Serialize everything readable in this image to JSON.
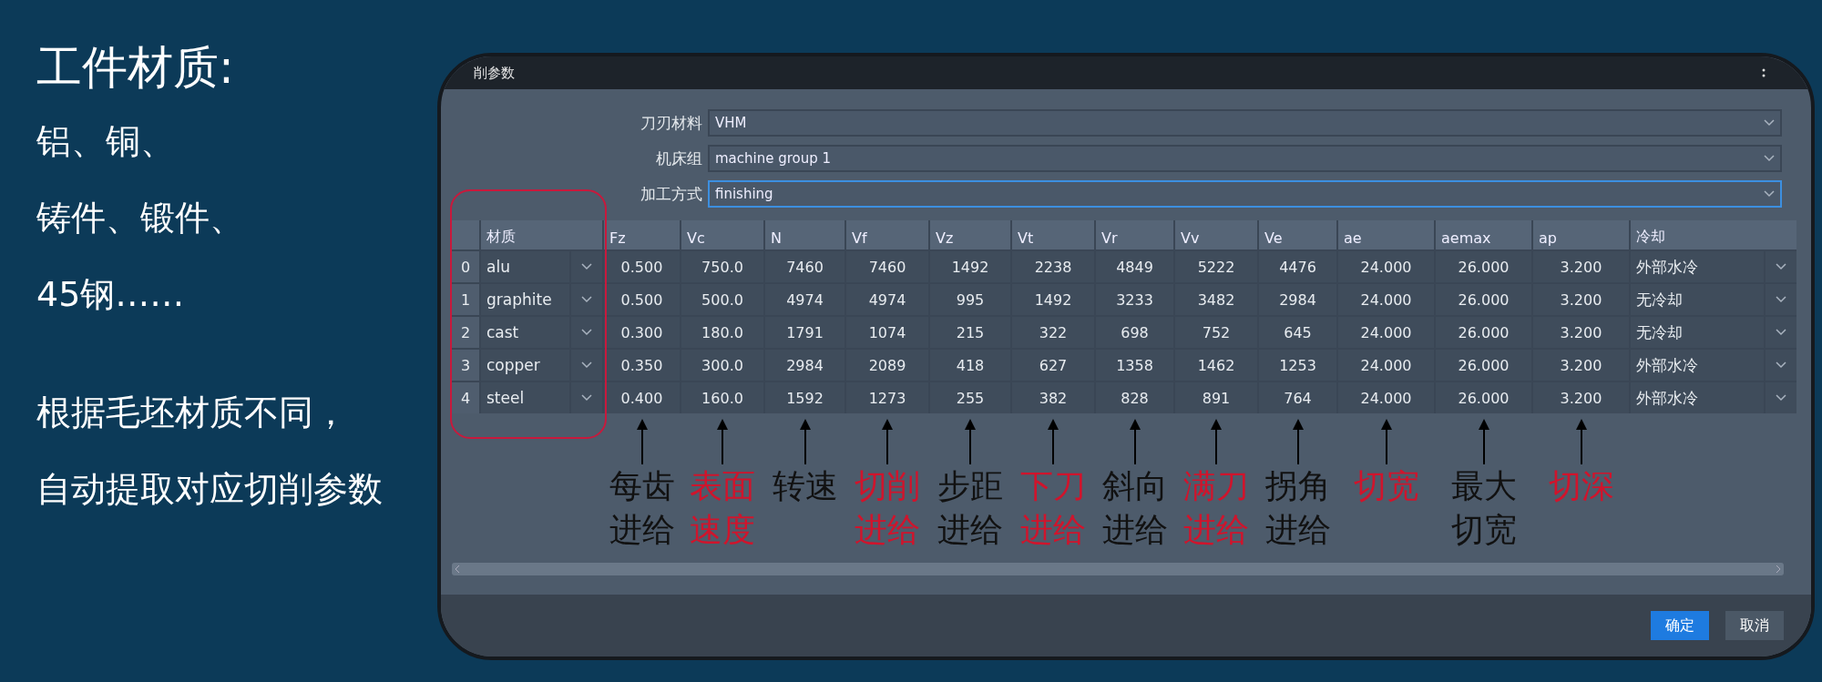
{
  "slide": {
    "heading": "工件材质:",
    "lines": [
      "铝、铜、",
      "铸件、锻件、",
      "45钢……"
    ],
    "note_lines": [
      "根据毛坯材质不同，",
      "自动提取对应切削参数"
    ]
  },
  "window": {
    "title": "削参数"
  },
  "form": [
    {
      "label": "刀刃材料",
      "value": "VHM",
      "focused": false
    },
    {
      "label": "机床组",
      "value": "machine group 1",
      "focused": false
    },
    {
      "label": "加工方式",
      "value": "finishing",
      "focused": true
    }
  ],
  "table": {
    "columns": [
      "",
      "材质",
      "Fz",
      "Vc",
      "N",
      "Vf",
      "Vz",
      "Vt",
      "Vr",
      "Vv",
      "Ve",
      "ae",
      "aemax",
      "ap",
      "冷却"
    ],
    "rows": [
      {
        "index": "0",
        "material": "alu",
        "cells": [
          "0.500",
          "750.0",
          "7460",
          "7460",
          "1492",
          "2238",
          "4849",
          "5222",
          "4476",
          "24.000",
          "26.000",
          "3.200"
        ],
        "cooling": "外部水冷"
      },
      {
        "index": "1",
        "material": "graphite",
        "cells": [
          "0.500",
          "500.0",
          "4974",
          "4974",
          "995",
          "1492",
          "3233",
          "3482",
          "2984",
          "24.000",
          "26.000",
          "3.200"
        ],
        "cooling": "无冷却"
      },
      {
        "index": "2",
        "material": "cast",
        "cells": [
          "0.300",
          "180.0",
          "1791",
          "1074",
          "215",
          "322",
          "698",
          "752",
          "645",
          "24.000",
          "26.000",
          "3.200"
        ],
        "cooling": "无冷却"
      },
      {
        "index": "3",
        "material": "copper",
        "cells": [
          "0.350",
          "300.0",
          "2984",
          "2089",
          "418",
          "627",
          "1358",
          "1462",
          "1253",
          "24.000",
          "26.000",
          "3.200"
        ],
        "cooling": "外部水冷"
      },
      {
        "index": "4",
        "material": "steel",
        "cells": [
          "0.400",
          "160.0",
          "1592",
          "1273",
          "255",
          "382",
          "828",
          "891",
          "764",
          "24.000",
          "26.000",
          "3.200"
        ],
        "cooling": "外部水冷"
      }
    ]
  },
  "annotations": [
    {
      "lines": [
        "每齿",
        "进给"
      ],
      "color": "#111111"
    },
    {
      "lines": [
        "表面",
        "速度"
      ],
      "color": "#d0142c"
    },
    {
      "lines": [
        "转速"
      ],
      "color": "#111111"
    },
    {
      "lines": [
        "切削",
        "进给"
      ],
      "color": "#d0142c"
    },
    {
      "lines": [
        "步距",
        "进给"
      ],
      "color": "#111111"
    },
    {
      "lines": [
        "下刀",
        "进给"
      ],
      "color": "#d0142c"
    },
    {
      "lines": [
        "斜向",
        "进给"
      ],
      "color": "#111111"
    },
    {
      "lines": [
        "满刀",
        "进给"
      ],
      "color": "#d0142c"
    },
    {
      "lines": [
        "拐角",
        "进给"
      ],
      "color": "#111111"
    },
    {
      "lines": [
        "切宽"
      ],
      "color": "#d0142c"
    },
    {
      "lines": [
        "最大",
        "切宽"
      ],
      "color": "#111111"
    },
    {
      "lines": [
        "切深"
      ],
      "color": "#d0142c"
    }
  ],
  "buttons": [
    {
      "label": "确定",
      "kind": "primary"
    },
    {
      "label": "取消",
      "kind": "secondary"
    }
  ]
}
